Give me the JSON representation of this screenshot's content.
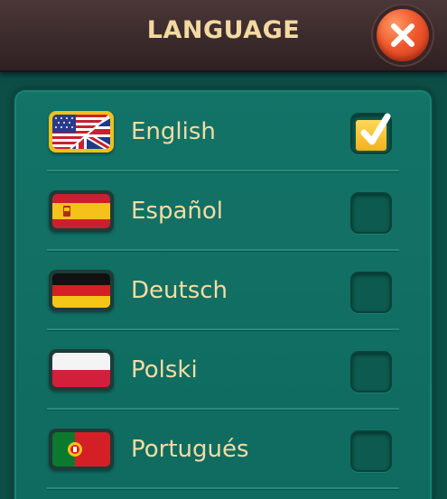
{
  "header": {
    "title": "LANGUAGE"
  },
  "languages": [
    {
      "id": "english",
      "label": "English",
      "selected": true
    },
    {
      "id": "espanol",
      "label": "Español",
      "selected": false
    },
    {
      "id": "deutsch",
      "label": "Deutsch",
      "selected": false
    },
    {
      "id": "polski",
      "label": "Polski",
      "selected": false
    },
    {
      "id": "portugues",
      "label": "Portugués",
      "selected": false
    }
  ],
  "colors": {
    "header_bg": "#3c2b2c",
    "title_text": "#f3d9a2",
    "panel_bg": "#137367",
    "label_text": "#f4dca4",
    "close_button": "#f0582e",
    "checkmark": "#f1b21a"
  }
}
